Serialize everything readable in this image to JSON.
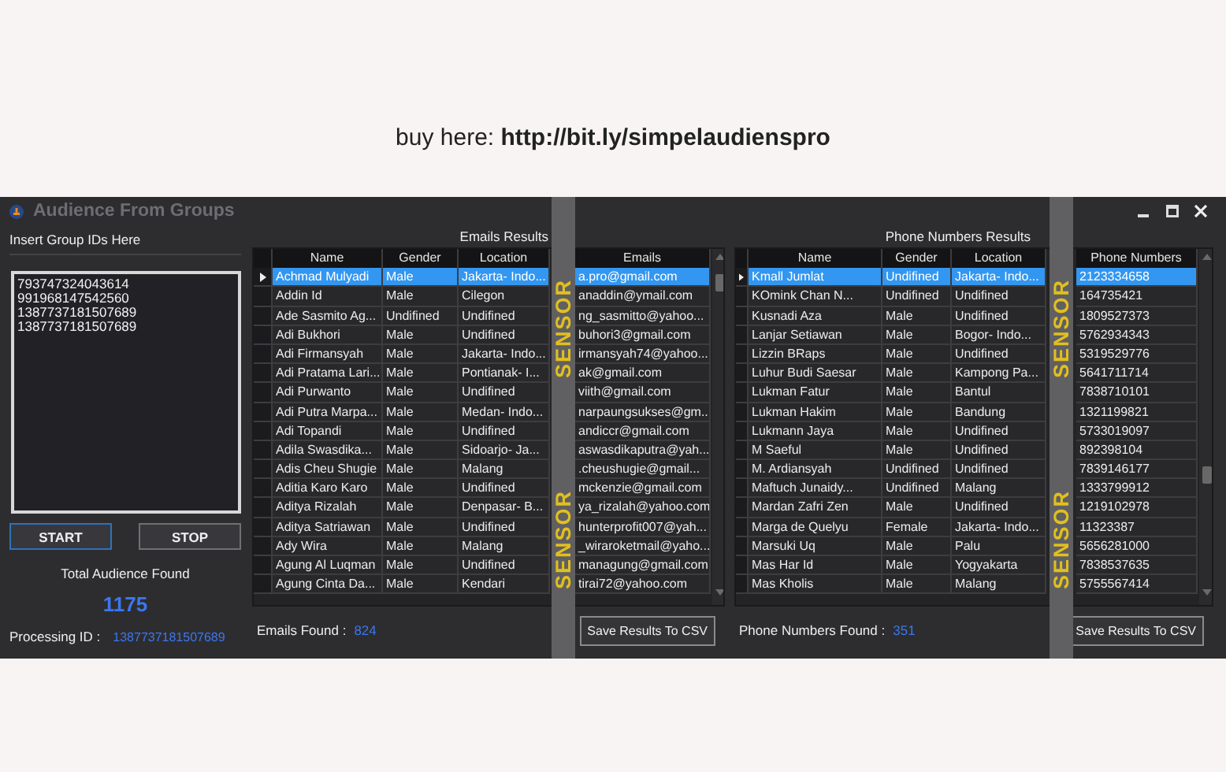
{
  "promo": {
    "text": "buy here: **http://bit.ly/simpelaudienspro**"
  },
  "window": {
    "title": "Audience From Groups"
  },
  "input_panel": {
    "label": "Insert Group IDs Here",
    "group_ids": [
      "793747324043614",
      "991968147542560",
      "1387737181507689",
      "1387737181507689"
    ],
    "buttons": [
      {
        "label": "START",
        "focused": true
      },
      {
        "label": "STOP",
        "focused": false
      }
    ],
    "total_label": "Total Audience Found",
    "total": "1175",
    "processing_label": "Processing ID :",
    "processing_id": "1387737181507689"
  },
  "results": [
    {
      "title": "Emails Results",
      "columns": [
        "Name",
        "Gender",
        "Location",
        "Emails"
      ],
      "rows": [
        {
          "cells": [
            "Achmad Mulyadi",
            "Male",
            "Jakarta- Indo...",
            "a.pro@gmail.com"
          ],
          "selected": true
        },
        {
          "cells": [
            "Addin Id",
            "Male",
            "Cilegon",
            "anaddin@ymail.com"
          ],
          "selected": false
        },
        {
          "cells": [
            "Ade Sasmito Ag...",
            "Undifined",
            "Undifined",
            "ng_sasmitto@yahoo..."
          ],
          "selected": false
        },
        {
          "cells": [
            "Adi Bukhori",
            "Male",
            "Undifined",
            "buhori3@gmail.com"
          ],
          "selected": false
        },
        {
          "cells": [
            "Adi Firmansyah",
            "Male",
            "Jakarta- Indo...",
            "irmansyah74@yahoo..."
          ],
          "selected": false
        },
        {
          "cells": [
            "Adi Pratama Lari...",
            "Male",
            "Pontianak- I...",
            "ak@gmail.com"
          ],
          "selected": false
        },
        {
          "cells": [
            "Adi Purwanto",
            "Male",
            "Undifined",
            "viith@gmail.com"
          ],
          "selected": false
        },
        {
          "cells": [
            "Adi Putra Marpa...",
            "Male",
            "Medan- Indo...",
            "narpaungsukses@gm..."
          ],
          "selected": false
        },
        {
          "cells": [
            "Adi Topandi",
            "Male",
            "Undifined",
            "andiccr@gmail.com"
          ],
          "selected": false
        },
        {
          "cells": [
            "Adila Swasdika...",
            "Male",
            "Sidoarjo- Ja...",
            "aswasdikaputra@yah..."
          ],
          "selected": false
        },
        {
          "cells": [
            "Adis Cheu Shugie",
            "Male",
            "Malang",
            ".cheushugie@gmail..."
          ],
          "selected": false
        },
        {
          "cells": [
            "Aditia Karo Karo",
            "Male",
            "Undifined",
            "mckenzie@gmail.com"
          ],
          "selected": false
        },
        {
          "cells": [
            "Aditya Rizalah",
            "Male",
            "Denpasar- B...",
            "ya_rizalah@yahoo.com"
          ],
          "selected": false
        },
        {
          "cells": [
            "Aditya Satriawan",
            "Male",
            "Undifined",
            "hunterprofit007@yah..."
          ],
          "selected": false
        },
        {
          "cells": [
            "Ady Wira",
            "Male",
            "Malang",
            "_wiraroketmail@yaho..."
          ],
          "selected": false
        },
        {
          "cells": [
            "Agung Al Luqman",
            "Male",
            "Undifined",
            "managung@gmail.com"
          ],
          "selected": false
        },
        {
          "cells": [
            "Agung Cinta Da...",
            "Male",
            "Kendari",
            "tirai72@yahoo.com"
          ],
          "selected": false
        }
      ],
      "found_label": "Emails Found :",
      "found_count": "824",
      "button": "Save Results To CSV"
    },
    {
      "title": "Phone Numbers Results",
      "columns": [
        "Name",
        "Gender",
        "Location",
        "Phone Numbers"
      ],
      "rows": [
        {
          "cells": [
            "Kmall Jumlat",
            "Undifined",
            "Jakarta- Indo...",
            "2123334658"
          ],
          "selected": true
        },
        {
          "cells": [
            "KOmink Chan N...",
            "Undifined",
            "Undifined",
            "164735421"
          ],
          "selected": false
        },
        {
          "cells": [
            "Kusnadi Aza",
            "Male",
            "Undifined",
            "1809527373"
          ],
          "selected": false
        },
        {
          "cells": [
            "Lanjar Setiawan",
            "Male",
            "Bogor- Indo...",
            "5762934343"
          ],
          "selected": false
        },
        {
          "cells": [
            "Lizzin BRaps",
            "Male",
            "Undifined",
            "5319529776"
          ],
          "selected": false
        },
        {
          "cells": [
            "Luhur Budi Saesar",
            "Male",
            "Kampong Pa...",
            "5641711714"
          ],
          "selected": false
        },
        {
          "cells": [
            "Lukman Fatur",
            "Male",
            "Bantul",
            "7838710101"
          ],
          "selected": false
        },
        {
          "cells": [
            "Lukman Hakim",
            "Male",
            "Bandung",
            "1321199821"
          ],
          "selected": false
        },
        {
          "cells": [
            "Lukmann Jaya",
            "Male",
            "Undifined",
            "5733019097"
          ],
          "selected": false
        },
        {
          "cells": [
            "M Saeful",
            "Male",
            "Undifined",
            "892398104"
          ],
          "selected": false
        },
        {
          "cells": [
            "M. Ardiansyah",
            "Undifined",
            "Undifined",
            "7839146177"
          ],
          "selected": false
        },
        {
          "cells": [
            "Maftuch Junaidy...",
            "Undifined",
            "Malang",
            "1333799912"
          ],
          "selected": false
        },
        {
          "cells": [
            "Mardan Zafri Zen",
            "Male",
            "Undifined",
            "1219102978"
          ],
          "selected": false
        },
        {
          "cells": [
            "Marga de Quelyu",
            "Female",
            "Jakarta- Indo...",
            "11323387"
          ],
          "selected": false
        },
        {
          "cells": [
            "Marsuki Uq",
            "Male",
            "Palu",
            "5656281000"
          ],
          "selected": false
        },
        {
          "cells": [
            "Mas Har Id",
            "Male",
            "Yogyakarta",
            "7838537635"
          ],
          "selected": false
        },
        {
          "cells": [
            "Mas Kholis",
            "Male",
            "Malang",
            "5755567414"
          ],
          "selected": false
        }
      ],
      "found_label": "Phone Numbers Found :",
      "found_count": "351",
      "button": "Save Results To CSV"
    }
  ],
  "censor_bars": [
    {
      "labels": [
        "SENSOR",
        "SENSOR"
      ]
    },
    {
      "labels": [
        "SENSOR",
        "SENSOR"
      ]
    }
  ]
}
